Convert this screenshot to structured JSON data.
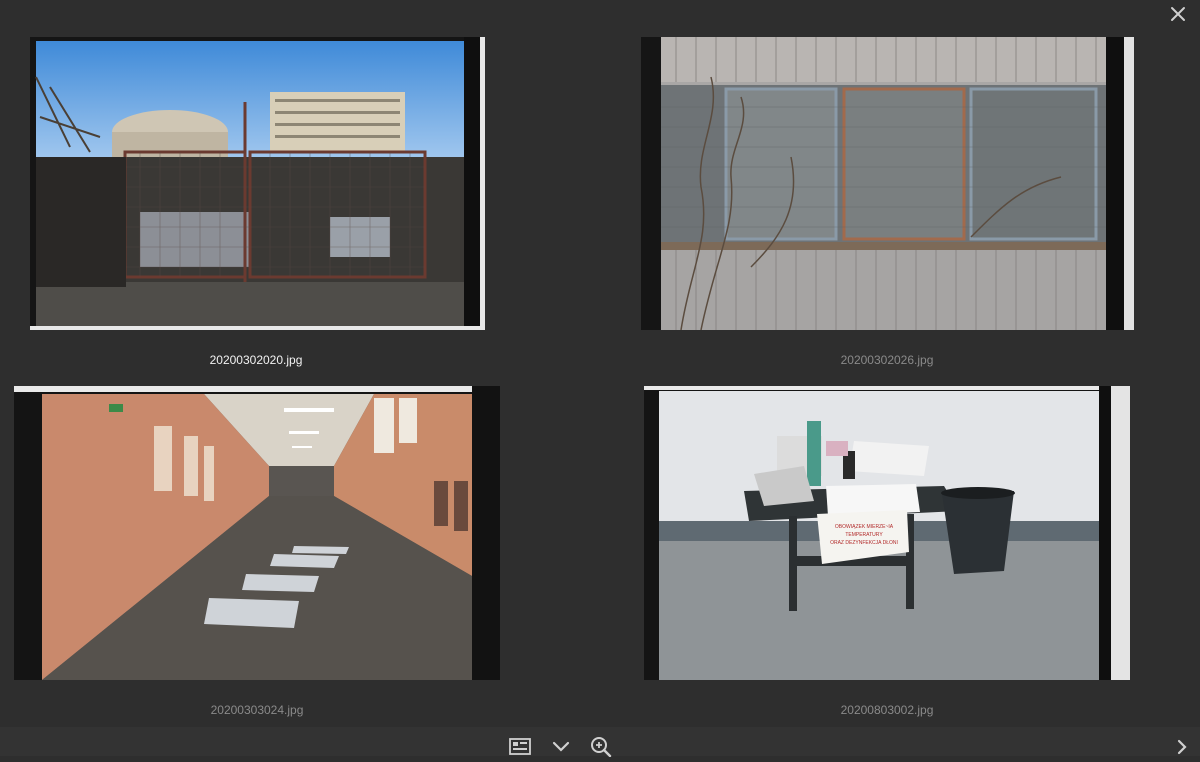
{
  "viewer": {
    "close_icon": "close-icon",
    "selected_index": 0
  },
  "photos": [
    {
      "filename": "20200302020.jpg",
      "selected": true,
      "scene": "fence-yard"
    },
    {
      "filename": "20200302026.jpg",
      "selected": false,
      "scene": "window-wall"
    },
    {
      "filename": "20200303024.jpg",
      "selected": false,
      "scene": "corridor"
    },
    {
      "filename": "20200803002.jpg",
      "selected": false,
      "scene": "table-room"
    }
  ],
  "photo4_signs": {
    "sign1": "OBOWIĄZEK MIERZE~IA",
    "sign2": "TEMPERATURY",
    "sign3": "ORAZ DEZYNFEKCJA DŁONI"
  },
  "toolbar": {
    "items": [
      "contact-sheet-icon",
      "chevron-down-icon",
      "zoom-in-icon",
      "chevron-right-icon"
    ]
  },
  "colors": {
    "background": "#2e2e2e",
    "caption": "#8a8a8a",
    "caption_selected": "#f2f2f2"
  }
}
